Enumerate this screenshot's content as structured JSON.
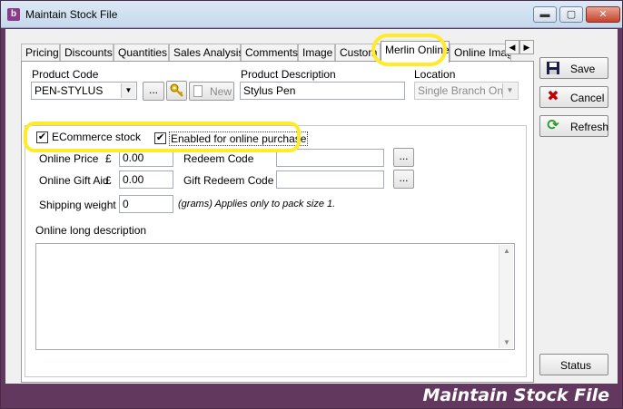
{
  "window": {
    "title": "Maintain Stock File",
    "app_icon": "b",
    "footer_title": "Maintain Stock File",
    "controls": {
      "minimize": "▬",
      "maximize": "▢",
      "close": "✕"
    }
  },
  "tabs": [
    {
      "label": "Pricing"
    },
    {
      "label": "Discounts"
    },
    {
      "label": "Quantities"
    },
    {
      "label": "Sales Analysis"
    },
    {
      "label": "Comments"
    },
    {
      "label": "Image"
    },
    {
      "label": "Custom"
    },
    {
      "label": "Merlin Online",
      "active": true
    },
    {
      "label": "Online Image"
    }
  ],
  "tab_scroll": {
    "left": "◀",
    "right": "▶"
  },
  "header": {
    "product_code_label": "Product Code",
    "product_code_value": "PEN-STYLUS",
    "browse_button": "...",
    "new_button": "New",
    "product_description_label": "Product Description",
    "product_description_value": "Stylus Pen",
    "location_label": "Location",
    "location_value": "Single Branch Only"
  },
  "online": {
    "ecommerce_label": "ECommerce stock",
    "ecommerce_checked": true,
    "enabled_label": "Enabled for online purchase",
    "enabled_checked": true,
    "check_mark": "✔",
    "online_price_label": "Online Price",
    "currency_symbol": "£",
    "online_price_value": "0.00",
    "online_gift_aid_label": "Online Gift Aid",
    "online_gift_aid_value": "0.00",
    "redeem_code_label": "Redeem Code",
    "redeem_code_value": "",
    "gift_redeem_code_label": "Gift Redeem Code",
    "gift_redeem_code_value": "",
    "ellipsis": "...",
    "shipping_weight_label": "Shipping weight",
    "shipping_weight_value": "0",
    "shipping_note": "(grams)  Applies only to pack size 1.",
    "long_description_label": "Online long description",
    "long_description_value": ""
  },
  "side_buttons": {
    "save": "Save",
    "cancel": "Cancel",
    "refresh": "Refresh",
    "status": "Status"
  },
  "colors": {
    "frame": "#63385f",
    "highlight": "#ffeb2a"
  }
}
